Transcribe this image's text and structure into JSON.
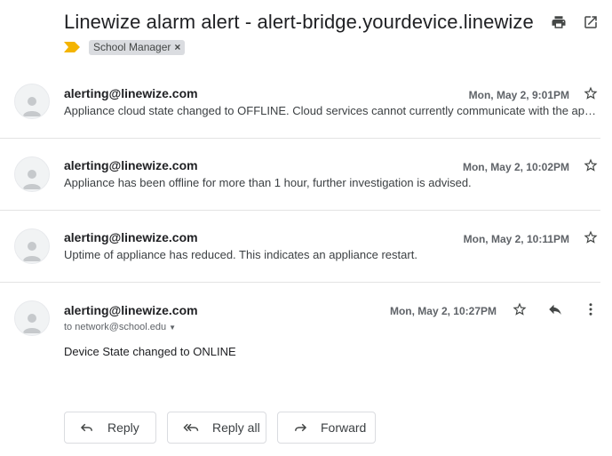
{
  "header": {
    "subject_main": "Linewize alarm alert",
    "subject_sep": " - ",
    "subject_host": "alert-bridge.yourdevice.linewize",
    "label": "School Manager",
    "label_remove": "×"
  },
  "messages": [
    {
      "sender": "alerting@linewize.com",
      "date": "Mon, May 2, 9:01PM",
      "snippet": "Appliance cloud state changed to OFFLINE. Cloud services cannot currently communicate with the appliance."
    },
    {
      "sender": "alerting@linewize.com",
      "date": "Mon, May 2, 10:02PM",
      "snippet": "Appliance has been offline for more than 1 hour, further investigation is advised."
    },
    {
      "sender": "alerting@linewize.com",
      "date": "Mon, May 2, 10:11PM",
      "snippet": "Uptime of appliance has reduced. This indicates an appliance restart."
    }
  ],
  "open_message": {
    "sender": "alerting@linewize.com",
    "date": "Mon, May 2, 10:27PM",
    "to": "to network@school.edu",
    "body": "Device State changed to ONLINE"
  },
  "actions": {
    "reply": "Reply",
    "reply_all": "Reply all",
    "forward": "Forward"
  },
  "colors": {
    "importance": "#f4b400",
    "label_bg": "#dadce0",
    "text": "#202124",
    "muted": "#5f6368"
  }
}
